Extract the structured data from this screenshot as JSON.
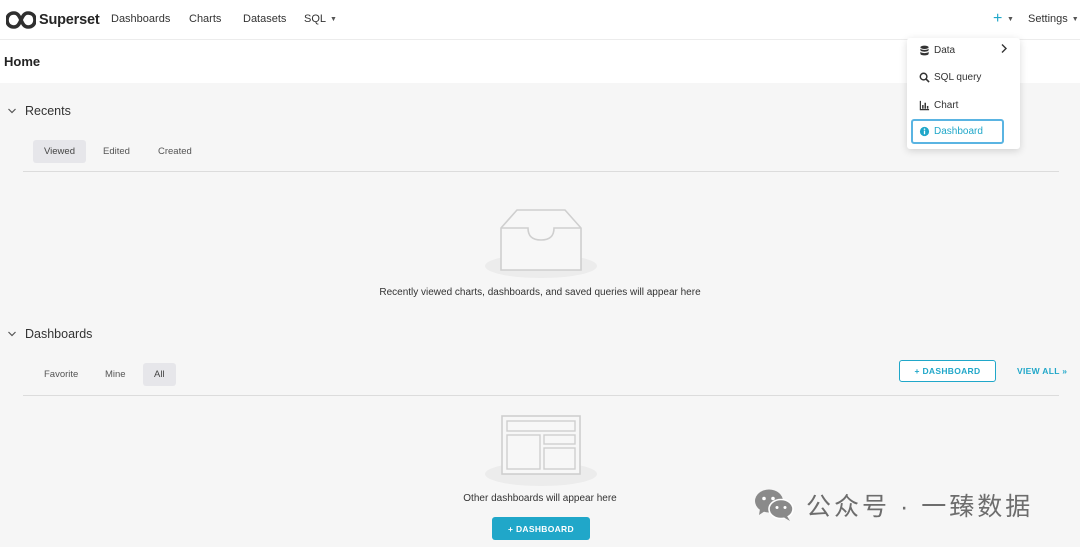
{
  "app": {
    "brand_name": "Superset"
  },
  "nav": {
    "items": [
      {
        "label": "Dashboards"
      },
      {
        "label": "Charts"
      },
      {
        "label": "Datasets"
      },
      {
        "label": "SQL"
      }
    ],
    "plus": "+",
    "settings": "Settings"
  },
  "new_menu": {
    "items": [
      {
        "label": "Data",
        "icon": "database-icon",
        "has_submenu": true
      },
      {
        "label": "SQL query",
        "icon": "search-icon"
      },
      {
        "label": "Chart",
        "icon": "bar-chart-icon"
      },
      {
        "label": "Dashboard",
        "icon": "info-circle-icon",
        "selected": true
      }
    ]
  },
  "page": {
    "title": "Home"
  },
  "recents": {
    "title": "Recents",
    "tabs": [
      {
        "label": "Viewed",
        "active": true
      },
      {
        "label": "Edited",
        "active": false
      },
      {
        "label": "Created",
        "active": false
      }
    ],
    "empty_message": "Recently viewed charts, dashboards, and saved queries will appear here"
  },
  "dashboards": {
    "title": "Dashboards",
    "tabs": [
      {
        "label": "Favorite",
        "active": false
      },
      {
        "label": "Mine",
        "active": false
      },
      {
        "label": "All",
        "active": true
      }
    ],
    "add_button": "+ DASHBOARD",
    "view_all": "VIEW ALL »",
    "empty_message": "Other dashboards will appear here",
    "empty_button": "+ DASHBOARD"
  },
  "watermark": {
    "text": "公众号 · 一臻数据"
  },
  "colors": {
    "accent": "#20a7c9",
    "focus_outline": "#5ab4e2",
    "content_bg": "#f6f6f6",
    "active_tab_bg": "#e6e6ea"
  }
}
